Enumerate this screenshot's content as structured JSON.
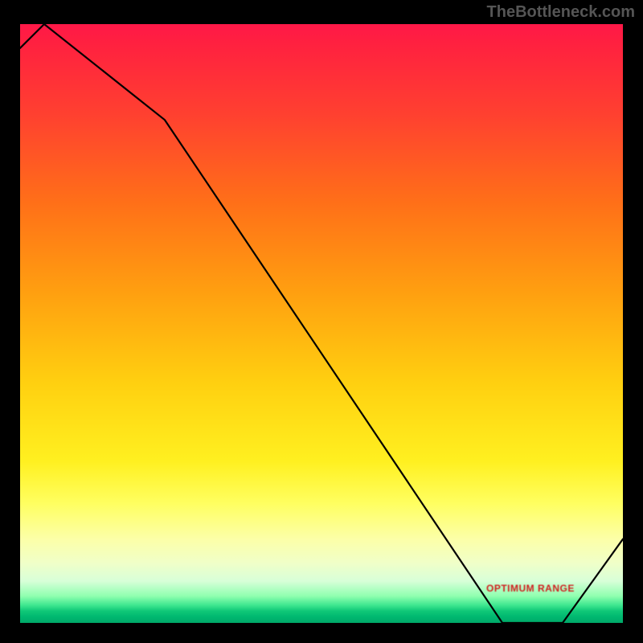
{
  "watermark": "TheBottleneck.com",
  "bottom_label": "OPTIMUM RANGE",
  "chart_data": {
    "type": "line",
    "title": "",
    "xlabel": "",
    "ylabel": "",
    "xlim": [
      0,
      100
    ],
    "ylim": [
      0,
      100
    ],
    "x": [
      0,
      4,
      24,
      80,
      86,
      90,
      100
    ],
    "values": [
      96,
      100,
      84,
      0,
      0,
      0,
      14
    ],
    "optimum_range_x": [
      78,
      90
    ],
    "gradient_note": "background gradient red→yellow→green top-to-bottom"
  }
}
